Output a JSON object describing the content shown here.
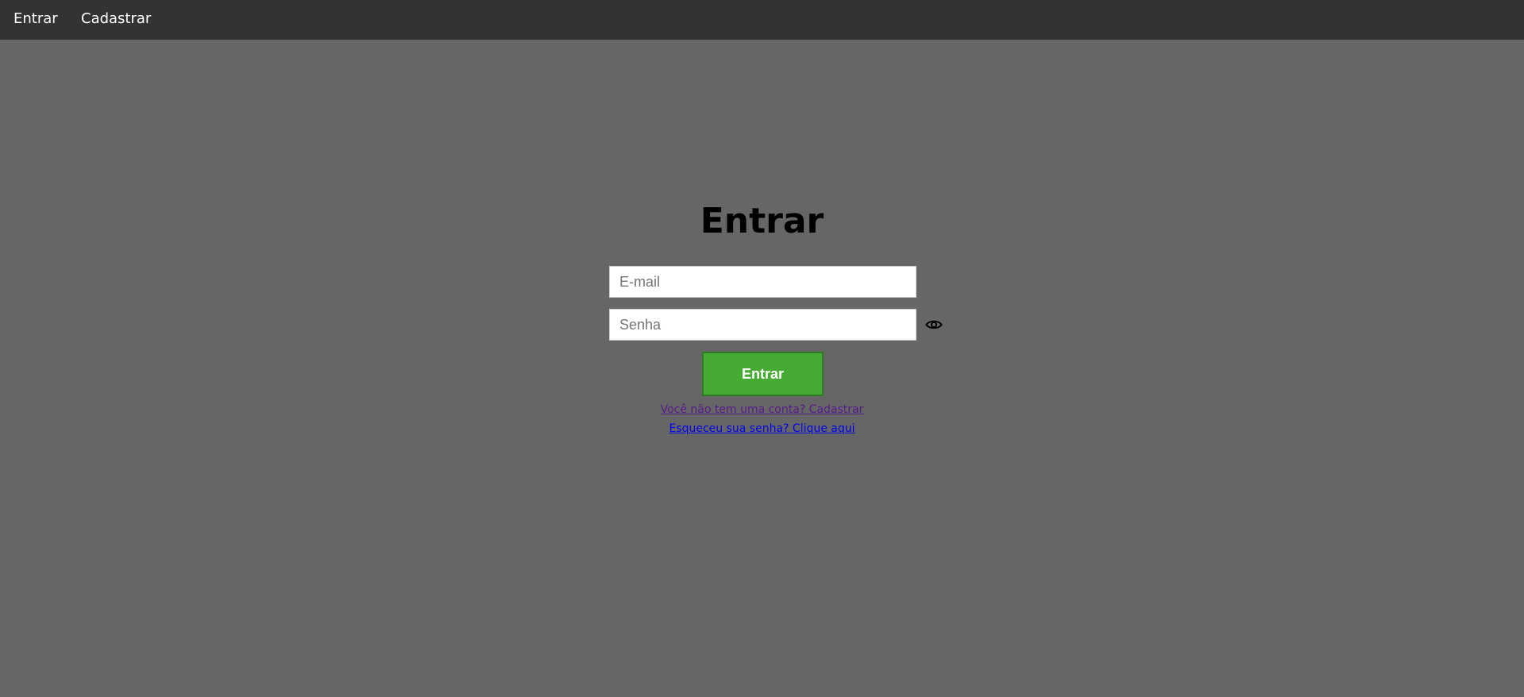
{
  "navbar": {
    "items": [
      {
        "label": "Entrar"
      },
      {
        "label": "Cadastrar"
      }
    ]
  },
  "login": {
    "title": "Entrar",
    "email_placeholder": "E-mail",
    "password_placeholder": "Senha",
    "password_toggle_icon": "eye-icon",
    "submit_label": "Entrar",
    "register_link": "Você não tem uma conta? Cadastrar",
    "forgot_link": "Esqueceu sua senha? Clique aqui"
  },
  "colors": {
    "background": "#666666",
    "navbar": "#333333",
    "button": "#46ab32",
    "visited_link": "#551a8b",
    "link": "#0000ee"
  }
}
